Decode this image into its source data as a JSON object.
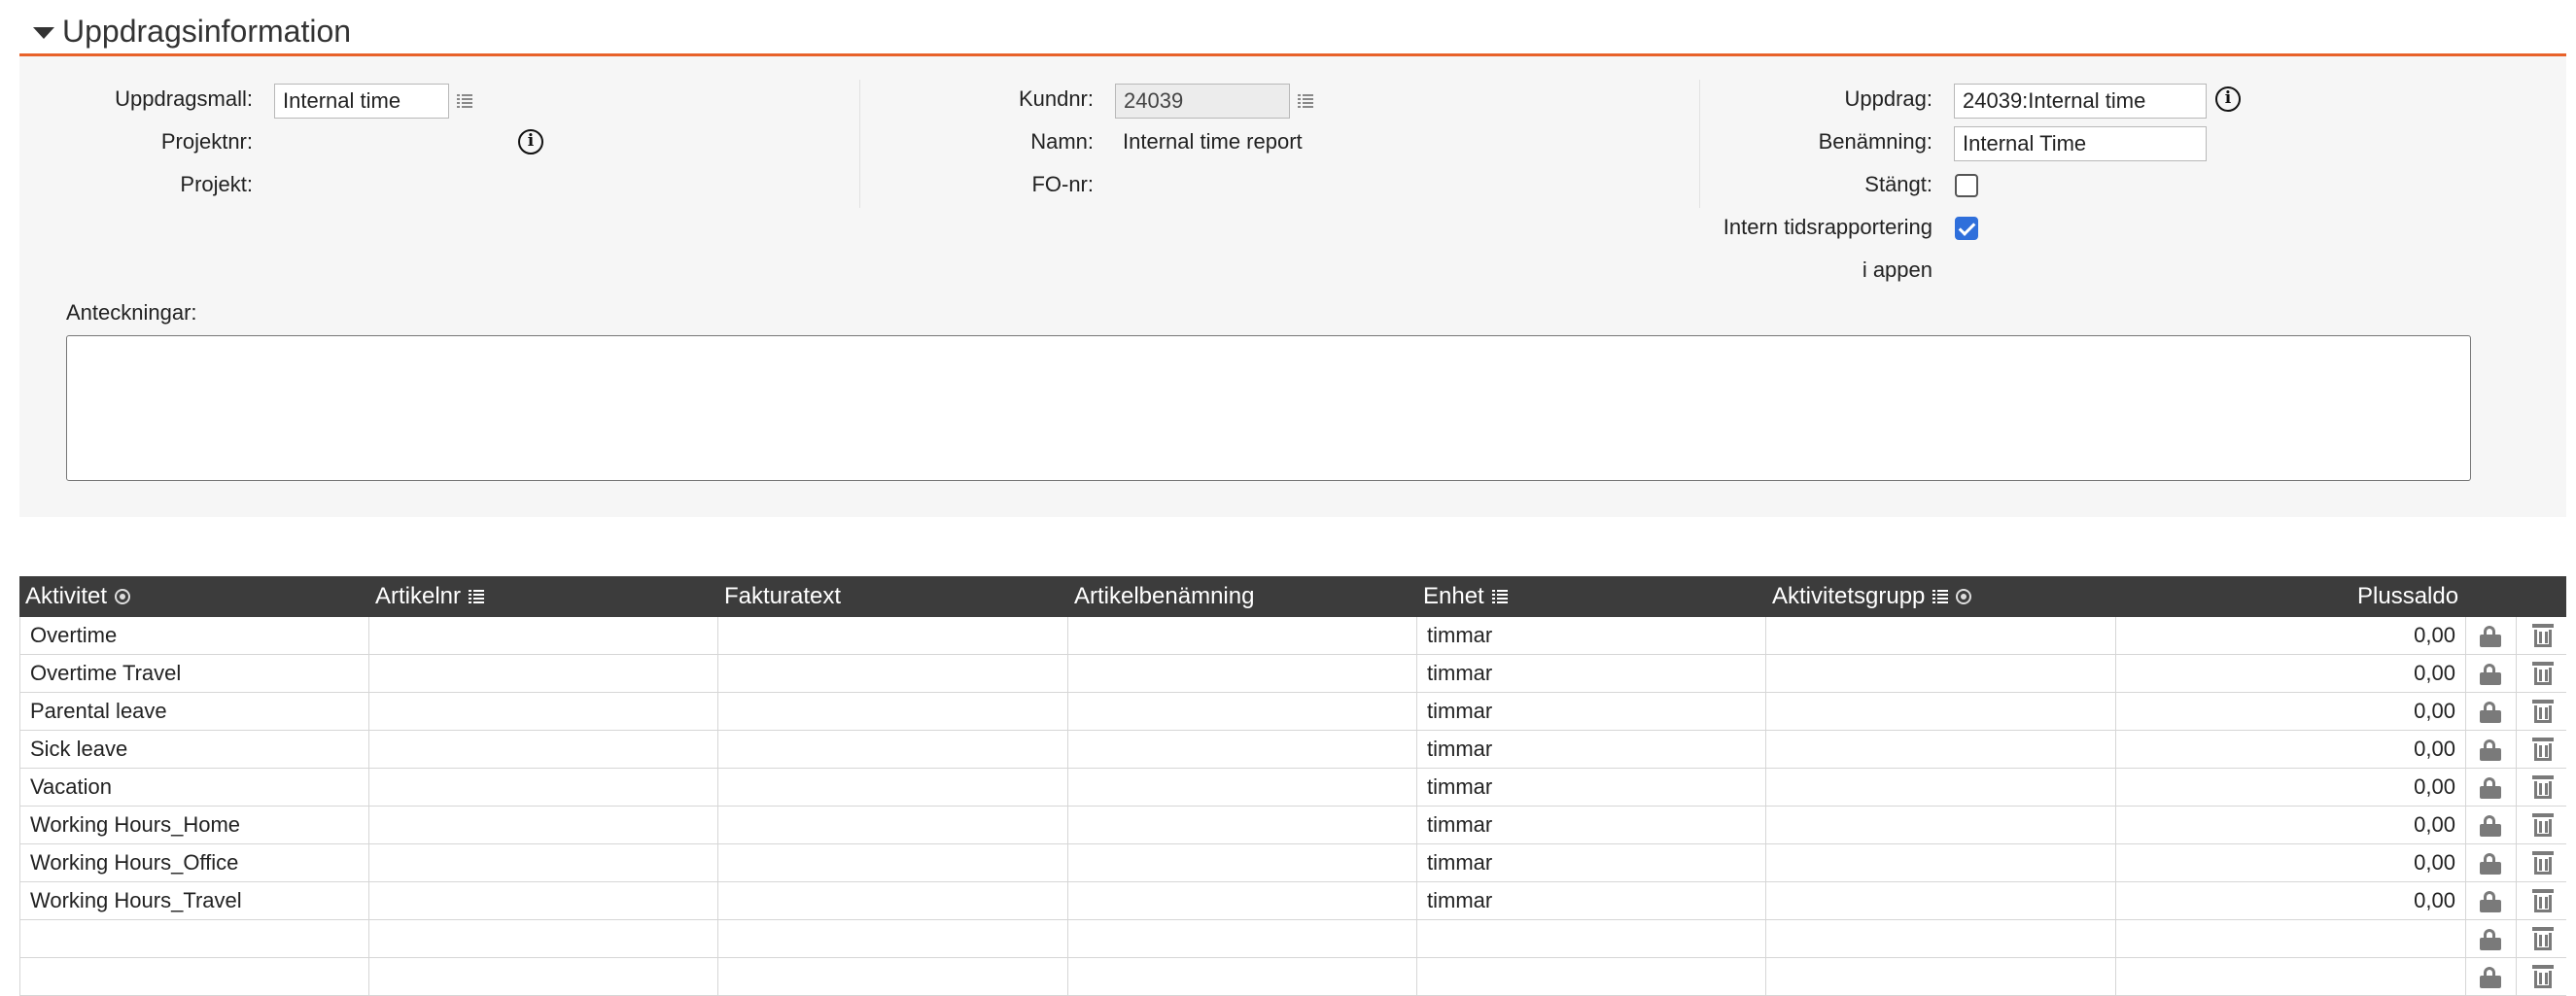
{
  "section": {
    "title": "Uppdragsinformation"
  },
  "left": {
    "template_label": "Uppdragsmall:",
    "template_value": "Internal time",
    "projectnr_label": "Projektnr:",
    "project_label": "Projekt:"
  },
  "middle": {
    "customer_no_label": "Kundnr:",
    "customer_no_value": "24039",
    "name_label": "Namn:",
    "name_value": "Internal time report",
    "org_no_label": "FO-nr:"
  },
  "right": {
    "assignment_label": "Uppdrag:",
    "assignment_value": "24039:Internal time",
    "designation_label": "Benämning:",
    "designation_value": "Internal Time",
    "closed_label": "Stängt:",
    "closed_checked": false,
    "internal_time_label_line1": "Intern tidsrapportering",
    "internal_time_label_line2": "i appen",
    "internal_time_checked": true
  },
  "notes": {
    "label": "Anteckningar:",
    "value": ""
  },
  "grid": {
    "columns": {
      "activity": "Aktivitet",
      "article_no": "Artikelnr",
      "invoice_text": "Fakturatext",
      "article_name": "Artikelbenämning",
      "unit": "Enhet",
      "activity_group": "Aktivitetsgrupp",
      "plus_balance": "Plussaldo"
    },
    "rows": [
      {
        "activity": "Overtime",
        "article_no": "",
        "invoice_text": "",
        "article_name": "",
        "unit": "timmar",
        "activity_group": "",
        "plus_balance": "0,00"
      },
      {
        "activity": "Overtime Travel",
        "article_no": "",
        "invoice_text": "",
        "article_name": "",
        "unit": "timmar",
        "activity_group": "",
        "plus_balance": "0,00"
      },
      {
        "activity": "Parental leave",
        "article_no": "",
        "invoice_text": "",
        "article_name": "",
        "unit": "timmar",
        "activity_group": "",
        "plus_balance": "0,00"
      },
      {
        "activity": "Sick leave",
        "article_no": "",
        "invoice_text": "",
        "article_name": "",
        "unit": "timmar",
        "activity_group": "",
        "plus_balance": "0,00"
      },
      {
        "activity": "Vacation",
        "article_no": "",
        "invoice_text": "",
        "article_name": "",
        "unit": "timmar",
        "activity_group": "",
        "plus_balance": "0,00"
      },
      {
        "activity": "Working Hours_Home",
        "article_no": "",
        "invoice_text": "",
        "article_name": "",
        "unit": "timmar",
        "activity_group": "",
        "plus_balance": "0,00"
      },
      {
        "activity": "Working Hours_Office",
        "article_no": "",
        "invoice_text": "",
        "article_name": "",
        "unit": "timmar",
        "activity_group": "",
        "plus_balance": "0,00"
      },
      {
        "activity": "Working Hours_Travel",
        "article_no": "",
        "invoice_text": "",
        "article_name": "",
        "unit": "timmar",
        "activity_group": "",
        "plus_balance": "0,00"
      },
      {
        "activity": "",
        "article_no": "",
        "invoice_text": "",
        "article_name": "",
        "unit": "",
        "activity_group": "",
        "plus_balance": ""
      },
      {
        "activity": "",
        "article_no": "",
        "invoice_text": "",
        "article_name": "",
        "unit": "",
        "activity_group": "",
        "plus_balance": ""
      }
    ]
  }
}
